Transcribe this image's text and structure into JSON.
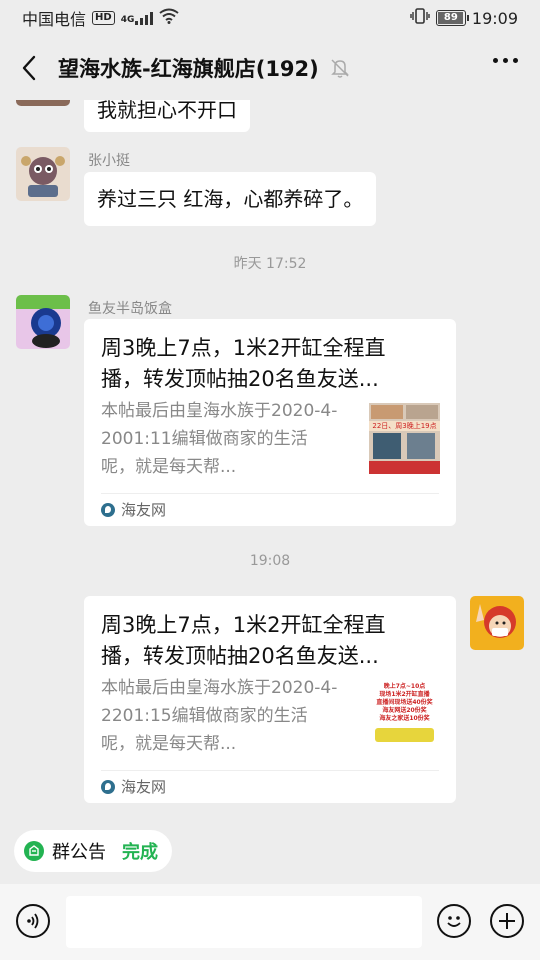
{
  "status_bar": {
    "carrier": "中国电信",
    "hd_badge": "HD",
    "network": "4G",
    "battery": "89",
    "battery_level": 0.89,
    "time": "19:09"
  },
  "header": {
    "title": "望海水族-红海旗舰店(192)",
    "back_icon": "chevron-left-icon",
    "mute_icon": "bell-muted-icon",
    "more_icon": "more-dots-icon"
  },
  "messages": [
    {
      "type": "text",
      "sender": "",
      "text": "我就担心不开口",
      "side": "left"
    },
    {
      "type": "text",
      "sender": "张小挺",
      "text": "养过三只 红海，心都养碎了。",
      "side": "left"
    },
    {
      "type": "time",
      "text": "昨天 17:52"
    },
    {
      "type": "link",
      "sender": "鱼友半岛饭盒",
      "side": "left",
      "title": "周3晚上7点，1米2开缸全程直播，转发顶帖抽20名鱼友送...",
      "desc": "本帖最后由皇海水族于2020-4-2001:11编辑做商家的生活呢，就是每天帮...",
      "thumb_text": "22日、周3晚上19点",
      "source": "海友网"
    },
    {
      "type": "time",
      "text": "19:08"
    },
    {
      "type": "link",
      "sender": "",
      "side": "right",
      "title": "周3晚上7点，1米2开缸全程直播，转发顶帖抽20名鱼友送...",
      "desc": "本帖最后由皇海水族于2020-4-2201:15编辑做商家的生活呢，就是每天帮...",
      "thumb_lines": [
        "晚上7点~10点",
        "现场1米2开缸直播",
        "直播间现场送40份奖",
        "海友网送20份奖",
        "海友之家送10份奖"
      ],
      "source": "海友网"
    }
  ],
  "announcement": {
    "label": "群公告",
    "done": "完成",
    "icon": "announcement-icon"
  },
  "input_bar": {
    "voice_icon": "voice-icon",
    "emoji_icon": "emoji-icon",
    "plus_icon": "plus-icon",
    "placeholder": ""
  },
  "colors": {
    "background": "#ededed",
    "accent_green": "#23b352",
    "bubble": "#ffffff"
  }
}
